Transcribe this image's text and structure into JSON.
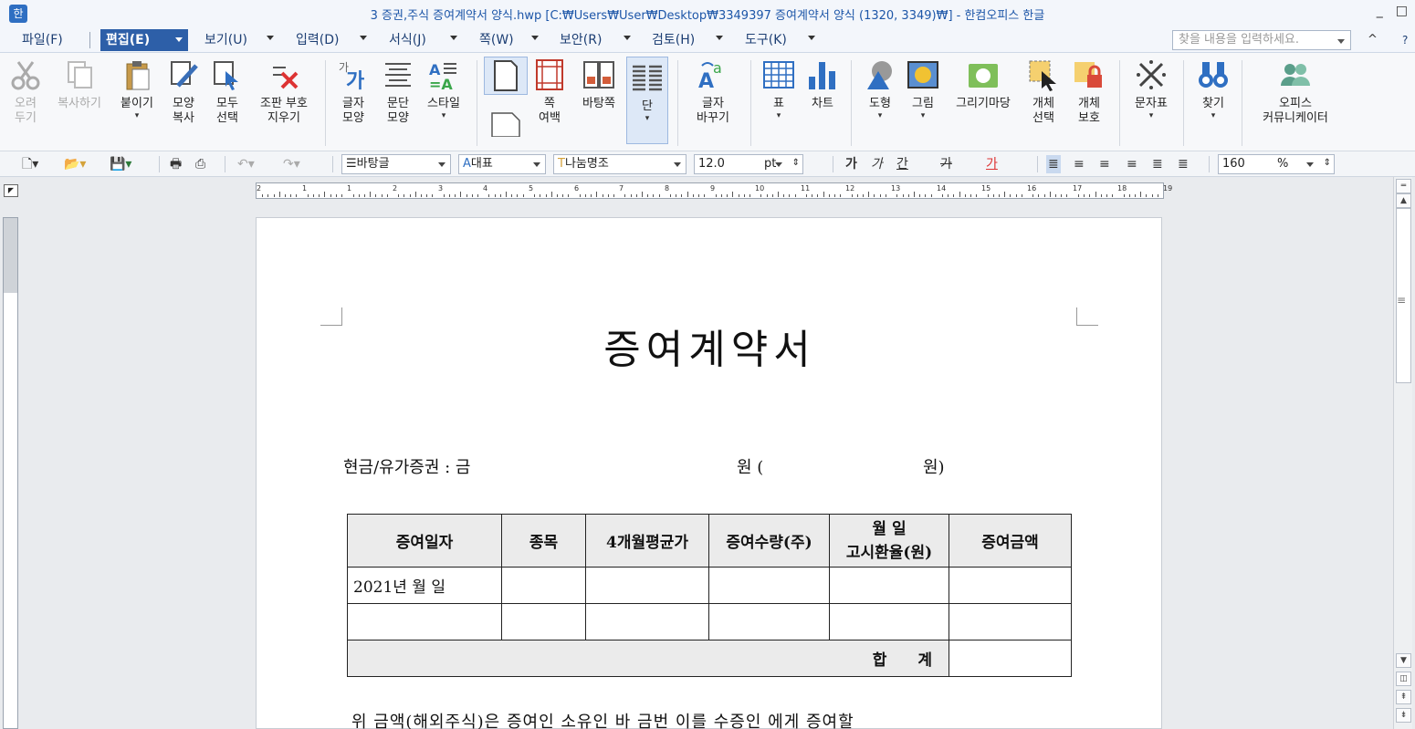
{
  "window": {
    "title": "3 증권,주식 증여계약서 양식.hwp [C:₩Users₩User₩Desktop₩3349397 증여계약서 양식 (1320, 3349)₩] - 한컴오피스 한글",
    "minimize": "_",
    "restore": "□"
  },
  "menu": {
    "items": [
      {
        "label": "파일(F)"
      },
      {
        "label": "편집(E)"
      },
      {
        "label": "보기(U)"
      },
      {
        "label": "입력(D)"
      },
      {
        "label": "서식(J)"
      },
      {
        "label": "쪽(W)"
      },
      {
        "label": "보안(R)"
      },
      {
        "label": "검토(H)"
      },
      {
        "label": "도구(K)"
      }
    ],
    "search_placeholder": "찾을 내용을 입력하세요.",
    "collapse": "^",
    "help": "?"
  },
  "ribbon": {
    "cut": [
      "오려",
      "두기"
    ],
    "copy": "복사하기",
    "paste": "붙이기",
    "format_copy": [
      "모양",
      "복사"
    ],
    "select_all": [
      "모두",
      "선택"
    ],
    "clear_marks": [
      "조판 부호",
      "지우기"
    ],
    "char_shape": [
      "글자",
      "모양"
    ],
    "para_shape": [
      "문단",
      "모양"
    ],
    "style": "스타일",
    "page_margin": [
      "쪽",
      "여백"
    ],
    "master_page": "바탕쪽",
    "column": "단",
    "char_replace": [
      "글자",
      "바꾸기"
    ],
    "table": "표",
    "chart": "차트",
    "shape": "도형",
    "picture": "그림",
    "drawing": "그리기마당",
    "object_select": [
      "개체",
      "선택"
    ],
    "object_protect": [
      "개체",
      "보호"
    ],
    "symbol": "문자표",
    "find": "찾기",
    "office_comm": [
      "오피스",
      "커뮤니케이터"
    ]
  },
  "format": {
    "style": "바탕글",
    "lang": "대표",
    "font": "나눔명조",
    "size": "12.0",
    "unit": "pt",
    "bold": "가",
    "italic": "가",
    "underline": "간",
    "strike": "가",
    "color": "가",
    "line_spacing": "160",
    "percent": "%"
  },
  "ruler": {
    "labels": [
      "2",
      "1",
      "1",
      "2",
      "3",
      "4",
      "5",
      "6",
      "7",
      "8",
      "9",
      "10",
      "11",
      "12",
      "13",
      "14",
      "15",
      "16",
      "17",
      "18",
      "19"
    ]
  },
  "document": {
    "title": "증여계약서",
    "line1_label": "현금/유가증권 : 금",
    "line1_won": "원 (",
    "line1_won_close": "원)",
    "table": {
      "headers": [
        "증여일자",
        "종목",
        "4개월평균가",
        "증여수량(주)",
        "월   일",
        "고시환율(원)",
        "증여금액"
      ],
      "row1_date": "2021년   월   일",
      "total_label": "합 계"
    },
    "bottom_line": "위 금액(해외주식)은 증여인            소유인 바 금번 이를 수증인          에게 증여할"
  }
}
